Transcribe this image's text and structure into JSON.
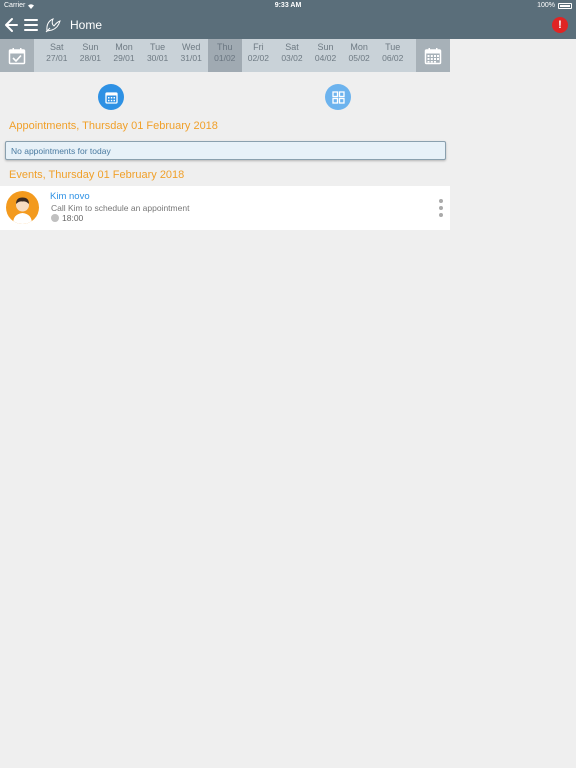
{
  "status_bar": {
    "carrier": "Carrier",
    "time": "9:33 AM",
    "battery": "100%"
  },
  "nav": {
    "title": "Home",
    "alert": "!"
  },
  "date_strip": {
    "days": [
      {
        "name": "Sat",
        "date": "27/01",
        "selected": false
      },
      {
        "name": "Sun",
        "date": "28/01",
        "selected": false
      },
      {
        "name": "Mon",
        "date": "29/01",
        "selected": false
      },
      {
        "name": "Tue",
        "date": "30/01",
        "selected": false
      },
      {
        "name": "Wed",
        "date": "31/01",
        "selected": false
      },
      {
        "name": "Thu",
        "date": "01/02",
        "selected": true
      },
      {
        "name": "Fri",
        "date": "02/02",
        "selected": false
      },
      {
        "name": "Sat",
        "date": "03/02",
        "selected": false
      },
      {
        "name": "Sun",
        "date": "04/02",
        "selected": false
      },
      {
        "name": "Mon",
        "date": "05/02",
        "selected": false
      },
      {
        "name": "Tue",
        "date": "06/02",
        "selected": false
      }
    ]
  },
  "appointments": {
    "title": "Appointments, Thursday 01 February 2018",
    "empty_message": "No appointments for today"
  },
  "events": {
    "title": "Events, Thursday 01 February 2018",
    "items": [
      {
        "name": "Kim novo",
        "description": "Call Kim to schedule an appointment",
        "time": "18:00"
      }
    ]
  },
  "colors": {
    "header": "#5a6e7a",
    "accent_orange": "#f0a02a",
    "accent_blue": "#2e91e4",
    "alert_red": "#e02424"
  }
}
